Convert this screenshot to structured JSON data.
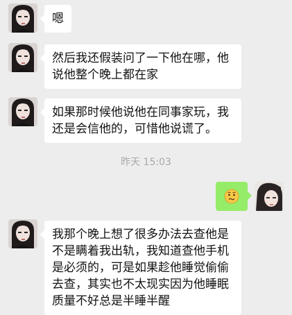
{
  "messages": [
    {
      "text": "嗯"
    },
    {
      "text": "然后我还假装问了一下他在哪，他说他整个晚上都在家"
    },
    {
      "text": "如果那时候他说他在同事家玩，我还是会信他的，可惜他说谎了。"
    },
    {
      "text": "我那个晚上想了很多办法去查他是不是瞒着我出轨，我知道查他手机是必须的，可是如果趁他睡觉偷偷去查，其实也不太现实因为他睡眠质量不好总是半睡半醒"
    }
  ],
  "timestamp": "昨天 15:03",
  "self_message": {
    "emoji": "confused-face"
  },
  "colors": {
    "background": "#ededed",
    "bubble_self": "#95ec69",
    "bubble_other": "#ffffff"
  }
}
